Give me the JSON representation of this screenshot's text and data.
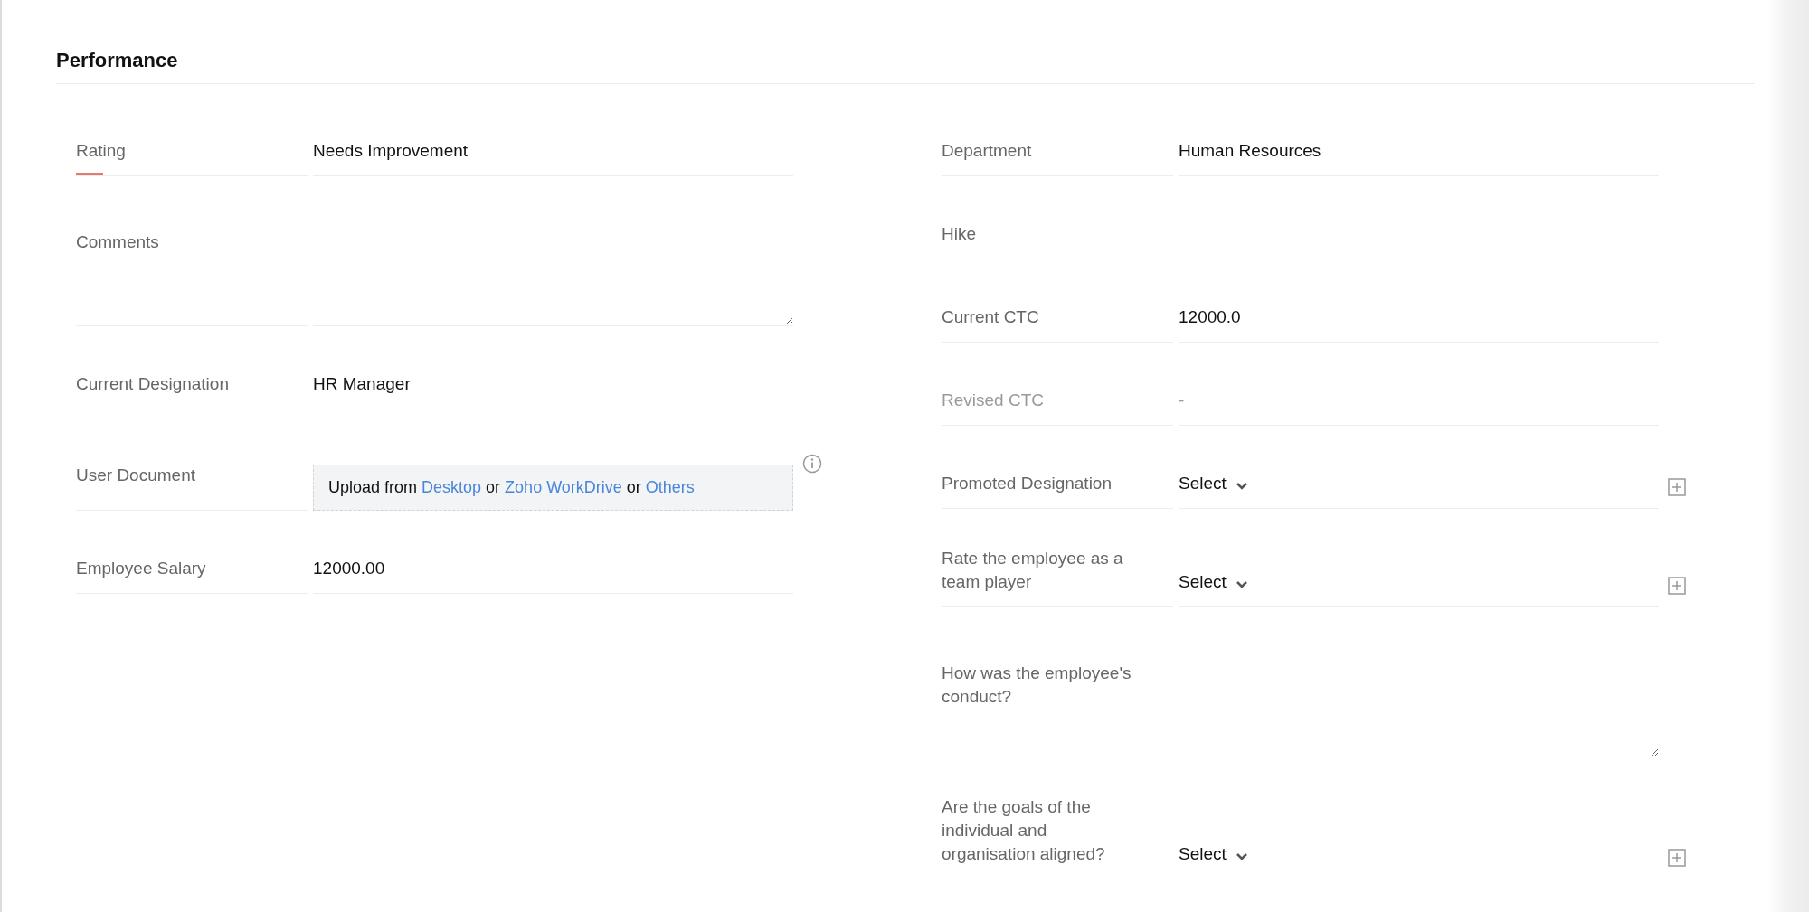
{
  "section": {
    "title": "Performance"
  },
  "columns": [
    {
      "fields": [
        {
          "kind": "text",
          "label": "Rating",
          "value": "Needs Improvement",
          "focused": true,
          "disabled": false
        },
        {
          "kind": "textarea",
          "label": "Comments",
          "focused": false,
          "disabled": false
        },
        {
          "kind": "text",
          "label": "Current Designation",
          "value": "HR Manager",
          "focused": false,
          "disabled": false
        },
        {
          "kind": "upload",
          "label": "User Document",
          "parts": [
            {
              "kind": "text",
              "text": "Upload from"
            },
            {
              "kind": "link",
              "text": "Desktop",
              "underlined": true
            },
            {
              "kind": "text",
              "text": "or"
            },
            {
              "kind": "link",
              "text": "Zoho WorkDrive",
              "underlined": false
            },
            {
              "kind": "text",
              "text": "or"
            },
            {
              "kind": "link",
              "text": "Others",
              "underlined": false
            }
          ],
          "focused": false,
          "disabled": false
        },
        {
          "kind": "text",
          "label": "Employee Salary",
          "value": "12000.00",
          "focused": false,
          "disabled": false
        }
      ]
    },
    {
      "fields": [
        {
          "kind": "text",
          "label": "Department",
          "value": "Human Resources",
          "focused": false,
          "disabled": false
        },
        {
          "kind": "text",
          "label": "Hike",
          "focused": false,
          "disabled": false
        },
        {
          "kind": "text",
          "label": "Current CTC",
          "value": "12000.0",
          "focused": false,
          "disabled": false
        },
        {
          "kind": "text",
          "label": "Revised CTC",
          "value": "-",
          "focused": false,
          "disabled": true
        },
        {
          "kind": "select",
          "label": "Promoted Designation",
          "value": "Select",
          "focused": false,
          "disabled": false
        },
        {
          "kind": "select",
          "label": "Rate the employee as a team player",
          "value": "Select",
          "focused": false,
          "disabled": false
        },
        {
          "kind": "textarea",
          "label": "How was the employee's conduct?",
          "focused": false,
          "disabled": false
        },
        {
          "kind": "select",
          "label": "Are the goals of the individual and organisation aligned?",
          "value": "Select",
          "focused": false,
          "disabled": false
        }
      ]
    }
  ]
}
